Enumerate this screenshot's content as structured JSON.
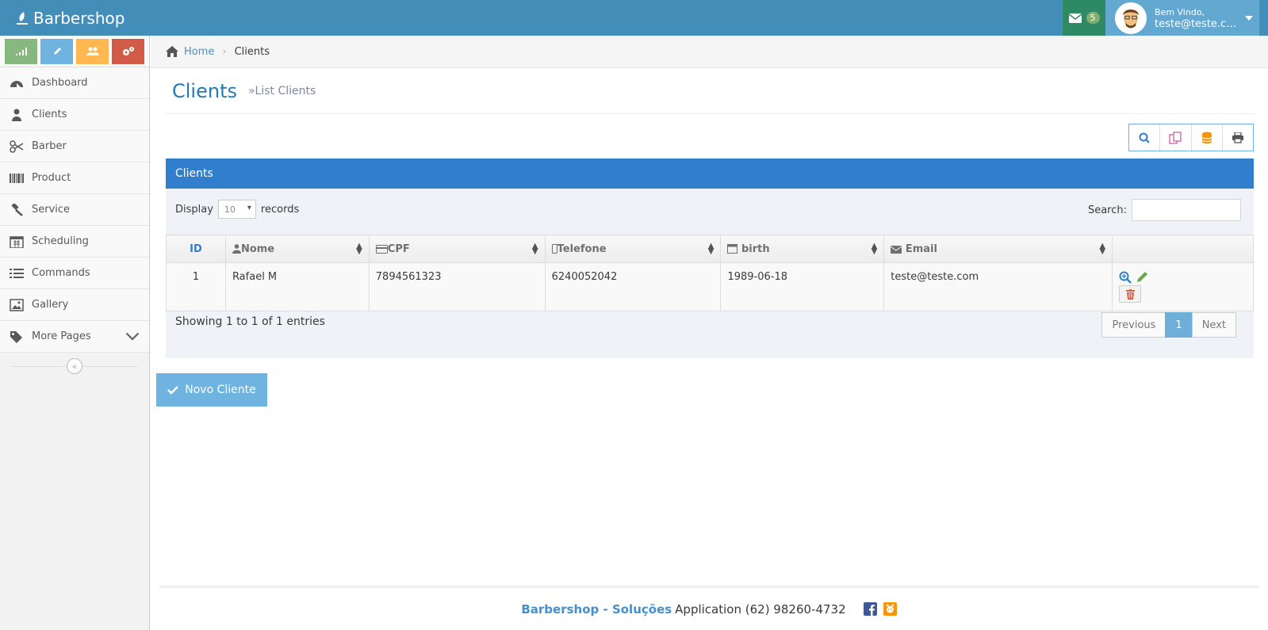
{
  "navbar": {
    "brand": "Barbershop",
    "messages_count": "5",
    "welcome": "Bem Vindo,",
    "user_email": "teste@teste.com"
  },
  "sidebar": {
    "items": [
      {
        "label": "Dashboard",
        "icon": "dashboard-icon"
      },
      {
        "label": "Clients",
        "icon": "user-icon"
      },
      {
        "label": "Barber",
        "icon": "scissors-icon"
      },
      {
        "label": "Product",
        "icon": "barcode-icon"
      },
      {
        "label": "Service",
        "icon": "gavel-icon"
      },
      {
        "label": "Scheduling",
        "icon": "calendar-icon"
      },
      {
        "label": "Commands",
        "icon": "list-icon"
      },
      {
        "label": "Gallery",
        "icon": "picture-icon"
      },
      {
        "label": "More Pages",
        "icon": "tag-icon"
      }
    ]
  },
  "breadcrumb": {
    "home": "Home",
    "current": "Clients"
  },
  "page": {
    "title": "Clients",
    "subtitle": "»List Clients"
  },
  "widget": {
    "title": "Clients"
  },
  "table_controls": {
    "display_label": "Display",
    "display_value": "10",
    "records_label": "records",
    "search_label": "Search:"
  },
  "table": {
    "headers": [
      "ID",
      "Nome",
      "CPF",
      "Telefone",
      "birth",
      "Email"
    ],
    "rows": [
      {
        "id": "1",
        "nome": "Rafael M",
        "cpf": "7894561323",
        "telefone": "6240052042",
        "birth": "1989-06-18",
        "email": "teste@teste.com"
      }
    ]
  },
  "pagination": {
    "info": "Showing 1 to 1 of 1 entries",
    "previous": "Previous",
    "current_page": "1",
    "next": "Next"
  },
  "new_button": {
    "label": "Novo Cliente"
  },
  "footer": {
    "brand": "Barbershop - Soluções",
    "text": "Application (62) 98260-4732"
  },
  "colors": {
    "navbar": "#438eb9",
    "widget_header": "#307ecc",
    "accent": "#6fb3e0"
  }
}
